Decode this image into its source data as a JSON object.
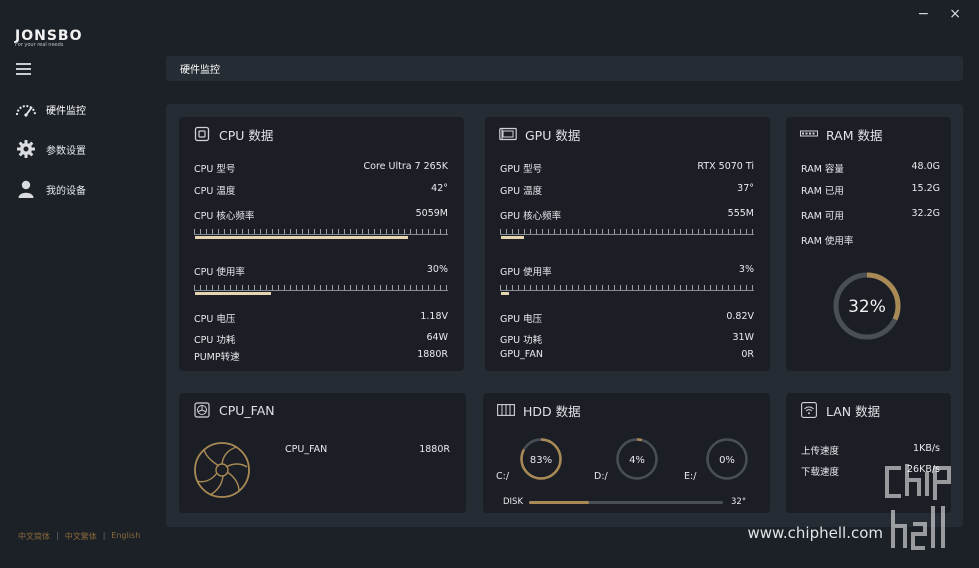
{
  "window": {
    "minimize": "−",
    "close": "×"
  },
  "brand": {
    "name": "JONSBO",
    "tagline": "For your real needs"
  },
  "nav": {
    "items": [
      {
        "label": "硬件监控",
        "icon": "speedometer-icon"
      },
      {
        "label": "参数设置",
        "icon": "gear-icon"
      },
      {
        "label": "我的设备",
        "icon": "user-icon"
      }
    ]
  },
  "languages": {
    "simplified": "中文简体",
    "traditional": "中文繁体",
    "english": "English",
    "sep": "|"
  },
  "page_title": "硬件监控",
  "cpu": {
    "title": "CPU 数据",
    "model_label": "CPU 型号",
    "model": "Core Ultra 7 265K",
    "temp_label": "CPU 温度",
    "temp": "42°",
    "clock_label": "CPU 核心频率",
    "clock": "5059M",
    "clock_fraction": 0.84,
    "usage_label": "CPU 使用率",
    "usage": "30%",
    "usage_fraction": 0.3,
    "voltage_label": "CPU 电压",
    "voltage": "1.18V",
    "power_label": "CPU 功耗",
    "power": "64W",
    "pump_label": "PUMP转速",
    "pump": "1880R"
  },
  "gpu": {
    "title": "GPU 数据",
    "model_label": "GPU 型号",
    "model": "RTX 5070 Ti",
    "temp_label": "GPU 温度",
    "temp": "37°",
    "clock_label": "GPU 核心频率",
    "clock": "555M",
    "clock_fraction": 0.09,
    "usage_label": "GPU 使用率",
    "usage": "3%",
    "usage_fraction": 0.03,
    "voltage_label": "GPU 电压",
    "voltage": "0.82V",
    "power_label": "GPU 功耗",
    "power": "31W",
    "fan_label": "GPU_FAN",
    "fan": "0R"
  },
  "ram": {
    "title": "RAM 数据",
    "capacity_label": "RAM 容量",
    "capacity": "48.0G",
    "used_label": "RAM 已用",
    "used": "15.2G",
    "free_label": "RAM 可用",
    "free": "32.2G",
    "usage_label": "RAM 使用率",
    "usage": "32%",
    "usage_fraction": 0.32
  },
  "cpu_fan": {
    "title": "CPU_FAN",
    "label": "CPU_FAN",
    "value": "1880R"
  },
  "hdd": {
    "title": "HDD 数据",
    "drives": [
      {
        "label": "C:/",
        "usage": "83%",
        "fraction": 0.83
      },
      {
        "label": "D:/",
        "usage": "4%",
        "fraction": 0.04
      },
      {
        "label": "E:/",
        "usage": "0%",
        "fraction": 0.0
      }
    ],
    "disk_label": "DISK",
    "disk_temp": "32°",
    "disk_fraction": 0.31
  },
  "lan": {
    "title": "LAN 数据",
    "upload_label": "上传速度",
    "upload": "1KB/s",
    "download_label": "下载速度",
    "download": "26KB/s"
  },
  "watermark": "www.chiphell.com",
  "colors": {
    "accent": "#a98a55",
    "bar_fill": "#e7d4b0",
    "track": "#4a4f57",
    "card": "#1b1f25",
    "panel": "#262c34",
    "bg": "#1c2027"
  }
}
